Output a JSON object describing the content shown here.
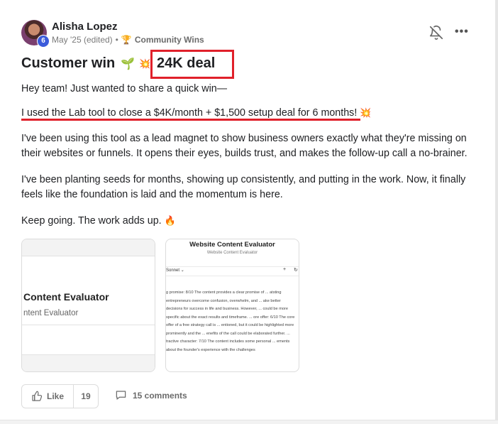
{
  "post": {
    "author": "Alisha Lopez",
    "level": "6",
    "timestamp": "May '25 (edited)",
    "separator": "•",
    "category": "Community Wins",
    "title": "Customer win",
    "title_emoji_1": "🌱",
    "title_emoji_2": "💥",
    "title_deal": "24K deal",
    "paragraph_1": "Hey team! Just wanted to share a quick win—",
    "paragraph_2": "I used the Lab tool to close a $4K/month + $1,500 setup deal for 6 months!",
    "paragraph_2_emoji": "💥",
    "paragraph_3": "I've been using this tool as a lead magnet to show business owners exactly what they're missing on their websites or funnels. It opens their eyes, builds trust, and makes the follow-up call a no-brainer.",
    "paragraph_4": "I've been planting seeds for months, showing up consistently, and putting in the work. Now, it finally feels like the foundation is laid and the momentum is here.",
    "paragraph_5": "Keep going. The work adds up.",
    "paragraph_5_emoji": "🔥",
    "highlight_color": "#e0202a"
  },
  "attachments": [
    {
      "title": "Content Evaluator",
      "subtitle": "ntent Evaluator"
    },
    {
      "title": "Website Content Evaluator",
      "subtitle": "Website Content Evaluator",
      "model": "Sonnet",
      "plus": "+",
      "body": "g promise: 8/10 The content provides a clear promise of ... atsting entrepreneurs overcome confusion, overwhelm, and ... ake better decisions for success in life and business. However, ... could be more specific about the exact results and timeframe. ... ore offer: 6/10 The core offer of a free strategy call is ... entioned, but it could be highlighted more prominently and the ... enefits of the call could be elaborated further. ... tractive character: 7/10 The content includes some personal ... ements about the founder's experience with the challenges"
    }
  ],
  "footer": {
    "like_label": "Like",
    "like_count": "19",
    "comments_label": "15 comments"
  },
  "icons": {
    "bell": "bell-off-icon",
    "more": "more-horizontal-icon",
    "like": "thumbs-up-icon",
    "comment": "comment-icon",
    "trophy": "trophy-icon"
  }
}
